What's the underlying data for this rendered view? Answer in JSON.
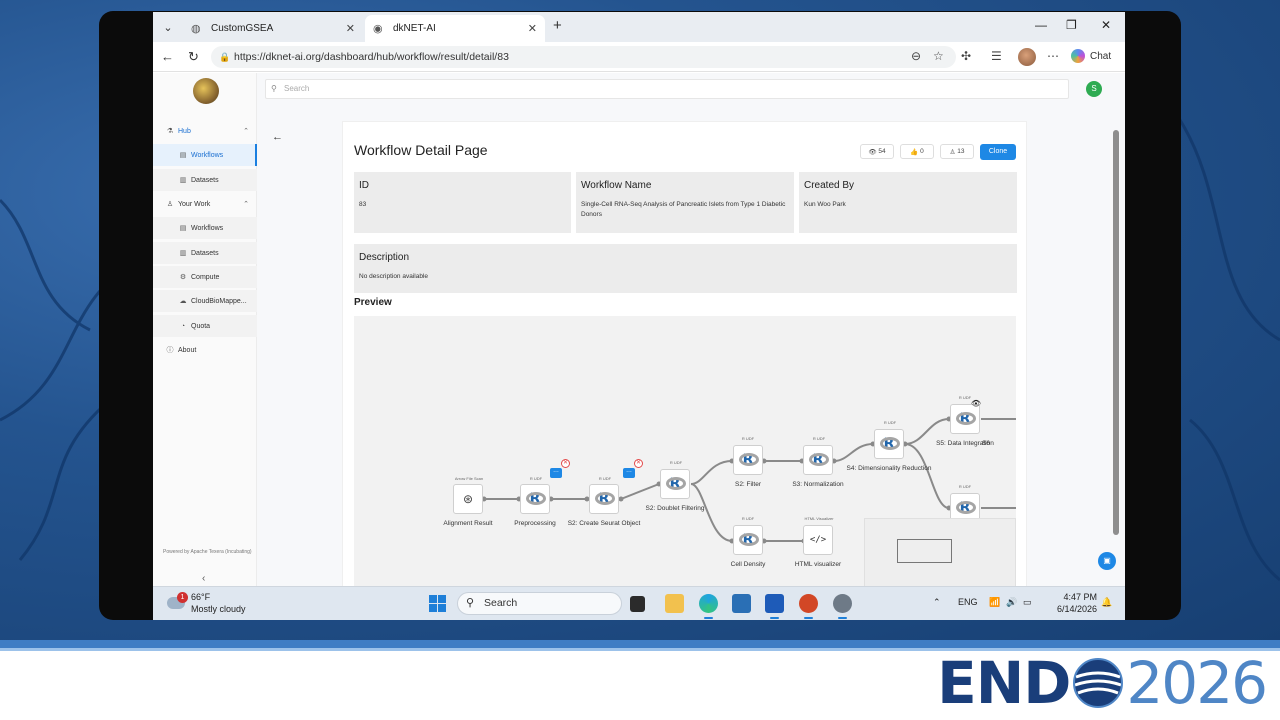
{
  "browser": {
    "tabs": [
      {
        "title": "CustomGSEA",
        "active": false
      },
      {
        "title": "dkNET-AI",
        "active": true
      }
    ],
    "url": "https://dknet-ai.org/dashboard/hub/workflow/result/detail/83",
    "chat_label": "Chat"
  },
  "sidebar": {
    "hub_label": "Hub",
    "hub_items": [
      "Workflows",
      "Datasets"
    ],
    "your_work_label": "Your Work",
    "your_work_items": [
      "Workflows",
      "Datasets",
      "Compute",
      "CloudBioMappe...",
      "Quota"
    ],
    "about_label": "About",
    "powered_by": "Powered by Apache Texera (Incubating)"
  },
  "topbar": {
    "search_placeholder": "Search",
    "user_initial": "S"
  },
  "detail": {
    "page_title": "Workflow Detail Page",
    "views": "54",
    "likes": "0",
    "clones_count": "13",
    "clone_label": "Clone",
    "id_label": "ID",
    "id_value": "83",
    "name_label": "Workflow Name",
    "name_value": "Single-Cell RNA-Seq Analysis of Pancreatic Islets from Type 1 Diabetic Donors",
    "created_label": "Created By",
    "created_value": "Kun Woo Park",
    "desc_label": "Description",
    "desc_value": "No description available",
    "preview_label": "Preview"
  },
  "workflow": {
    "tags": {
      "scan": "Arrow File Scan",
      "rudf": "R UDF",
      "html": "HTML Visualizer"
    },
    "nodes": [
      "Alignment Result",
      "Preprocessing",
      "S2: Create Seurat Object",
      "S2: Doublet Filtering",
      "S2: Filter",
      "S3: Normalization",
      "S4: Dimensionality Reduction",
      "S5: Data Integration",
      "S6",
      "Cell Density",
      "HTML visualizer"
    ]
  },
  "taskbar": {
    "temperature": "66°F",
    "condition": "Mostly cloudy",
    "weather_alert": "1",
    "search_label": "Search",
    "language": "ENG",
    "time": "4:47 PM",
    "date": "6/14/2026"
  },
  "branding": {
    "event_left": "END",
    "event_year": "2026"
  },
  "colors": {
    "accent": "#1e88e5",
    "brand_dark": "#1a3e7a",
    "brand_light": "#4f86c6"
  }
}
